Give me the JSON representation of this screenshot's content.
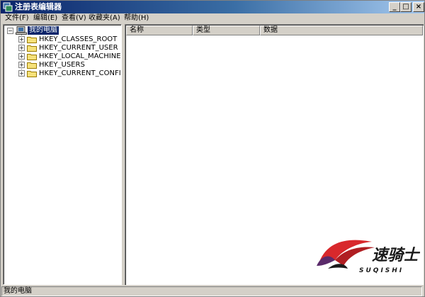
{
  "window": {
    "title": "注册表编辑器",
    "icon": "registry-editor-icon",
    "buttons": {
      "minimize": "_",
      "maximize": "□",
      "close": "×"
    }
  },
  "menu": {
    "items": [
      {
        "label": "文件(F)"
      },
      {
        "label": "编辑(E)"
      },
      {
        "label": "查看(V)"
      },
      {
        "label": "收藏夹(A)"
      },
      {
        "label": "帮助(H)"
      }
    ]
  },
  "tree": {
    "root": {
      "label": "我的电脑",
      "expander": "−",
      "icon": "computer-icon",
      "selected": true
    },
    "children": [
      {
        "label": "HKEY_CLASSES_ROOT",
        "expander": "+",
        "icon": "folder-icon"
      },
      {
        "label": "HKEY_CURRENT_USER",
        "expander": "+",
        "icon": "folder-icon"
      },
      {
        "label": "HKEY_LOCAL_MACHINE",
        "expander": "+",
        "icon": "folder-icon"
      },
      {
        "label": "HKEY_USERS",
        "expander": "+",
        "icon": "folder-icon"
      },
      {
        "label": "HKEY_CURRENT_CONFIG",
        "expander": "+",
        "icon": "folder-icon"
      }
    ]
  },
  "list": {
    "columns": [
      {
        "label": "名称"
      },
      {
        "label": "类型"
      },
      {
        "label": "数据"
      }
    ],
    "rows": []
  },
  "status": {
    "text": "我的电脑"
  },
  "watermark": {
    "brand": "速骑士",
    "sub": "SUQISHI",
    "colors": {
      "red": "#d8282c",
      "dark": "#1a1a1a",
      "purple": "#5a2a6a"
    }
  },
  "colors": {
    "title_start": "#0a246a",
    "title_end": "#a6caf0",
    "face": "#d4d0c8",
    "selection": "#0a246a"
  }
}
